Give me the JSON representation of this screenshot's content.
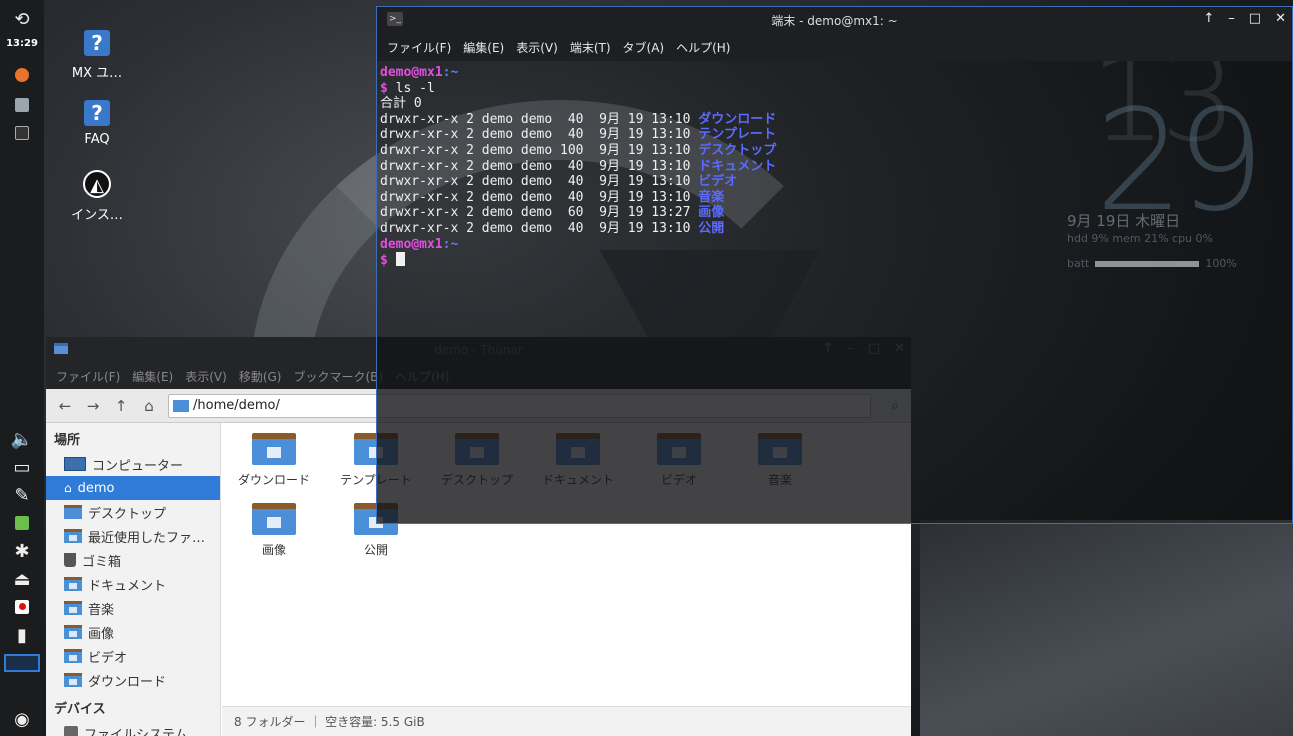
{
  "panel": {
    "clock": "13:29"
  },
  "desktop": {
    "icons": [
      {
        "label": "MX ユ…",
        "glyph": "?"
      },
      {
        "label": "FAQ",
        "glyph": "?"
      },
      {
        "label": "インス…",
        "glyph": "MX"
      }
    ]
  },
  "conky": {
    "hour": "13",
    "minute": "29",
    "date": "9月 19日 木曜日",
    "stats": "hdd 9% mem 21% cpu  0%",
    "batt_label": "batt",
    "batt_value": "100%",
    "batt_level": 1.0
  },
  "terminal": {
    "title": "端末 - demo@mx1: ~",
    "menu": [
      "ファイル(F)",
      "編集(E)",
      "表示(V)",
      "端末(T)",
      "タブ(A)",
      "ヘルプ(H)"
    ],
    "prompt_user": "demo@mx1",
    "prompt_dir": ":~",
    "prompt_sym": "$",
    "command": " ls -l",
    "total": "合計 0",
    "entries": [
      {
        "perm": "drwxr-xr-x 2 demo demo  40  9月 19 13:10 ",
        "name": "ダウンロード"
      },
      {
        "perm": "drwxr-xr-x 2 demo demo  40  9月 19 13:10 ",
        "name": "テンプレート"
      },
      {
        "perm": "drwxr-xr-x 2 demo demo 100  9月 19 13:10 ",
        "name": "デスクトップ"
      },
      {
        "perm": "drwxr-xr-x 2 demo demo  40  9月 19 13:10 ",
        "name": "ドキュメント"
      },
      {
        "perm": "drwxr-xr-x 2 demo demo  40  9月 19 13:10 ",
        "name": "ビデオ"
      },
      {
        "perm": "drwxr-xr-x 2 demo demo  40  9月 19 13:10 ",
        "name": "音楽"
      },
      {
        "perm": "drwxr-xr-x 2 demo demo  60  9月 19 13:27 ",
        "name": "画像"
      },
      {
        "perm": "drwxr-xr-x 2 demo demo  40  9月 19 13:10 ",
        "name": "公開"
      }
    ]
  },
  "thunar": {
    "title": "demo - Thunar",
    "menu": [
      "ファイル(F)",
      "編集(E)",
      "表示(V)",
      "移動(G)",
      "ブックマーク(B)",
      "ヘルプ(H)"
    ],
    "location": "/home/demo/",
    "places_heading": "場所",
    "places": [
      "コンピューター",
      "demo",
      "デスクトップ",
      "最近使用したファ…",
      "ゴミ箱",
      "ドキュメント",
      "音楽",
      "画像",
      "ビデオ",
      "ダウンロード"
    ],
    "devices_heading": "デバイス",
    "devices": [
      "ファイルシステム"
    ],
    "files": [
      "ダウンロード",
      "テンプレート",
      "デスクトップ",
      "ドキュメント",
      "ビデオ",
      "音楽",
      "画像",
      "公開"
    ],
    "status": "8 フォルダー ｜ 空き容量: 5.5 GiB"
  },
  "colors": {
    "accent": "#2f7bd8",
    "prompt": "#e050e0",
    "dir": "#5b6bff"
  }
}
